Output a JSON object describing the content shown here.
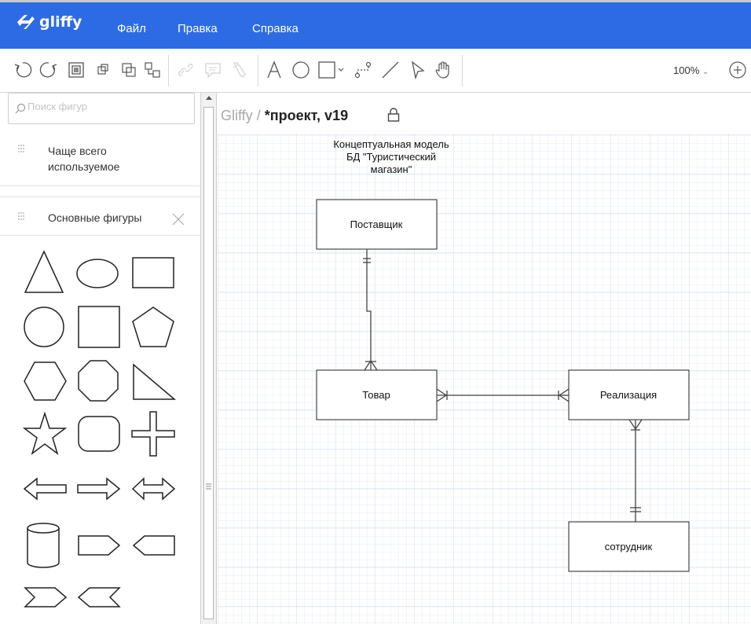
{
  "app": {
    "logo_text": "gliffy",
    "menu": [
      "Файл",
      "Правка",
      "Справка"
    ]
  },
  "toolbar": {
    "zoom": "100%",
    "tools": [
      "undo-icon",
      "redo-icon",
      "bring-to-front-icon",
      "group-icon",
      "send-to-back-icon",
      "connect-icon",
      "link-icon",
      "comment-icon",
      "style-painter-icon",
      "text-tool-icon",
      "ellipse-tool-icon",
      "rectangle-tool-icon",
      "connector-tool-icon",
      "line-tool-icon",
      "pointer-tool-icon",
      "hand-tool-icon",
      "zoom-in-icon"
    ]
  },
  "sidebar": {
    "search_placeholder": "Поиск фигур",
    "sections": [
      {
        "label": "Чаще всего используемое"
      },
      {
        "label": "Основные фигуры"
      }
    ],
    "shapes": [
      "triangle",
      "ellipse",
      "rectangle",
      "circle",
      "square",
      "pentagon",
      "hexagon",
      "octagon",
      "right-triangle",
      "star",
      "rounded-rectangle",
      "cross",
      "left-arrow",
      "right-arrow",
      "double-arrow",
      "cylinder",
      "pentagon-right",
      "pentagon-left",
      "chevron-right",
      "chevron-left"
    ]
  },
  "document": {
    "breadcrumb_root": "Gliffy",
    "separator": " / ",
    "title": "*проект, v19"
  },
  "diagram": {
    "title_lines": [
      "Концептуальная модель",
      "БД \"Туристический",
      "магазин\""
    ],
    "entities": [
      {
        "id": "supplier",
        "label": "Поставщик"
      },
      {
        "id": "product",
        "label": "Товар"
      },
      {
        "id": "sale",
        "label": "Реализация"
      },
      {
        "id": "employee",
        "label": "сотрудник"
      }
    ],
    "relations": [
      {
        "from": "supplier",
        "to": "product",
        "from_end": "one-and-only-one",
        "to_end": "one-or-many"
      },
      {
        "from": "product",
        "to": "sale",
        "from_end": "one-or-many",
        "to_end": "one-or-many"
      },
      {
        "from": "sale",
        "to": "employee",
        "from_end": "one-or-many",
        "to_end": "one-and-only-one"
      }
    ]
  },
  "colors": {
    "menubar": "#2d6be5",
    "grid_minor": "#e6ecf3",
    "grid_major": "#d3dae3",
    "shape_stroke": "#222222"
  }
}
